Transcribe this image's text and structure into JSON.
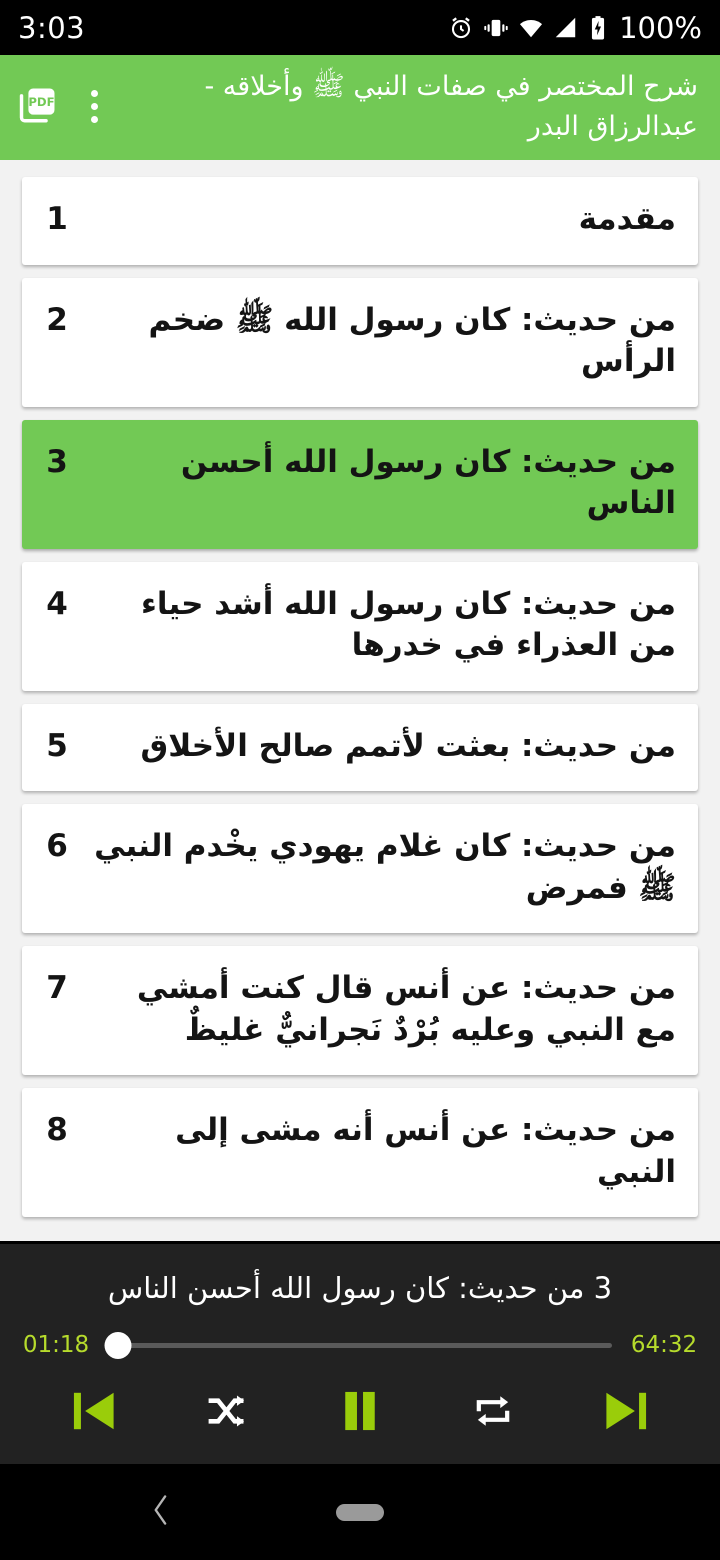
{
  "status_bar": {
    "time": "3:03",
    "battery_percent": "100%",
    "icons": [
      "alarm-icon",
      "vibrate-icon",
      "wifi-icon",
      "signal-icon",
      "battery-icon"
    ]
  },
  "app_bar": {
    "title": "شرح المختصر في صفات النبي ﷺ وأخلاقه - عبدالرزاق البدر",
    "pdf_button_label": "PDF",
    "overflow_label": "المزيد",
    "background_color": "#72c955"
  },
  "list": {
    "items": [
      {
        "number": "1",
        "title": "مقدمة",
        "selected": false
      },
      {
        "number": "2",
        "title": "من حديث: كان رسول الله ﷺ ضخم الرأس",
        "selected": false
      },
      {
        "number": "3",
        "title": "من حديث: كان رسول الله أحسن الناس",
        "selected": true
      },
      {
        "number": "4",
        "title": "من حديث: كان رسول الله أشد حياء من العذراء في خدرها",
        "selected": false
      },
      {
        "number": "5",
        "title": "من حديث: بعثت لأتمم صالح الأخلاق",
        "selected": false
      },
      {
        "number": "6",
        "title": "من حديث: كان غلام يهودي يخْدم النبي ﷺ فمرض",
        "selected": false
      },
      {
        "number": "7",
        "title": "من حديث: عن أنس قال كنت أمشي مع النبي وعليه بُرْدٌ نَجرانيٌّ غليظٌ",
        "selected": false
      },
      {
        "number": "8",
        "title": "من حديث: عن أنس أنه مشى إلى النبي",
        "selected": false
      }
    ]
  },
  "player": {
    "now_playing": "3  من حديث: كان رسول الله أحسن الناس",
    "elapsed_time": "01:18",
    "total_time": "64:32",
    "progress_percent": 2,
    "accent_color": "#9acd0a",
    "time_color": "#b6db2c",
    "background_color": "#222222",
    "controls": [
      {
        "name": "previous-button",
        "label": "السابق",
        "state": "active"
      },
      {
        "name": "shuffle-button",
        "label": "عشوائي",
        "state": "inactive"
      },
      {
        "name": "play-pause-button",
        "label": "إيقاف مؤقت",
        "state": "playing"
      },
      {
        "name": "repeat-button",
        "label": "تكرار",
        "state": "inactive"
      },
      {
        "name": "next-button",
        "label": "التالي",
        "state": "active"
      }
    ]
  },
  "nav_bar": {
    "back_label": "رجوع",
    "home_label": "الرئيسية"
  }
}
